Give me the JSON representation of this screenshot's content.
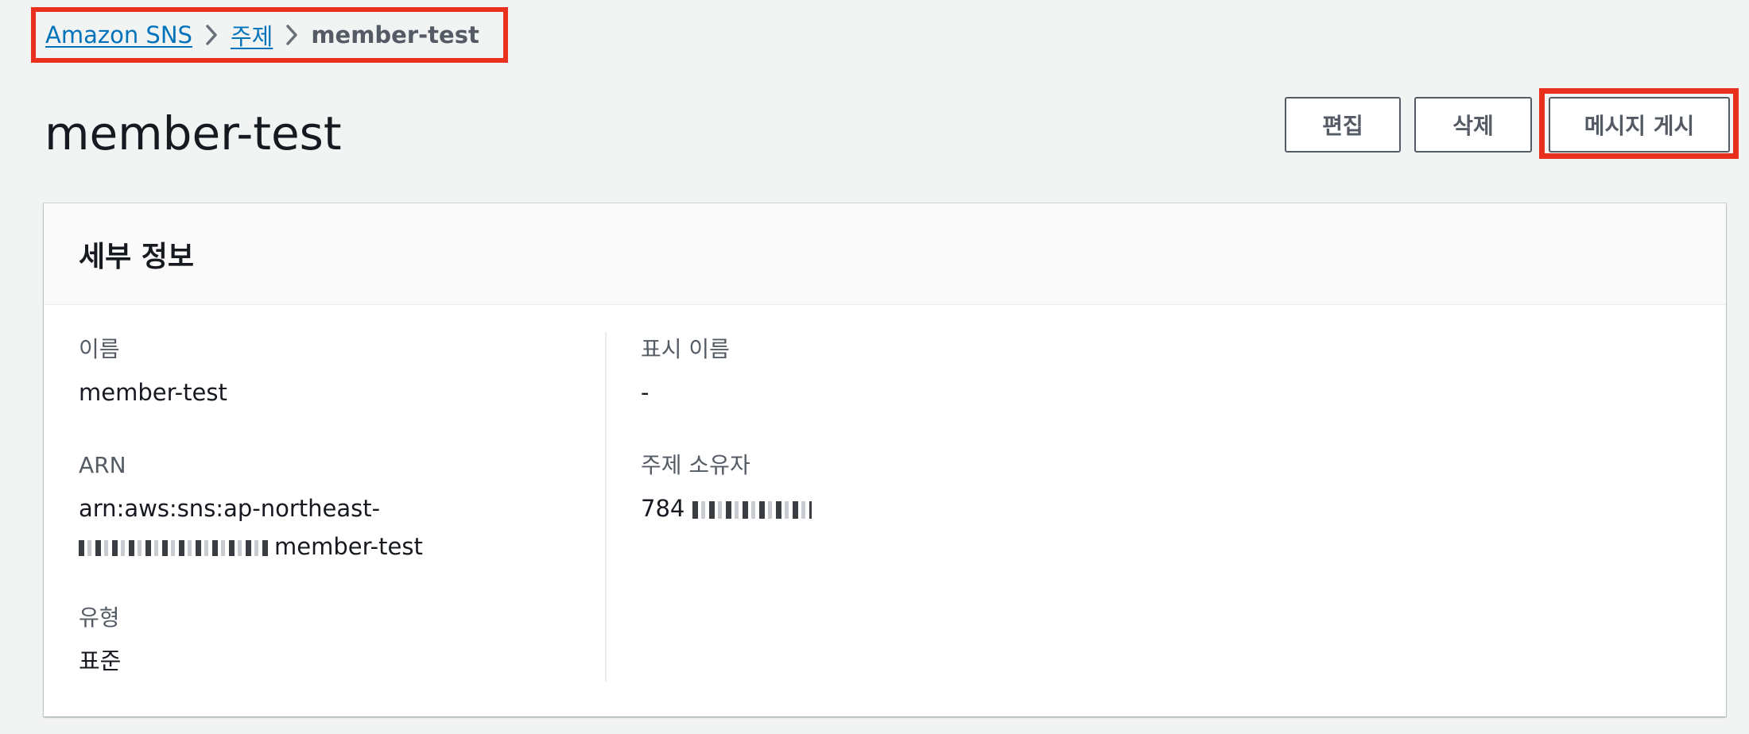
{
  "breadcrumb": {
    "items": [
      "Amazon SNS",
      "주제"
    ],
    "current": "member-test"
  },
  "header": {
    "title": "member-test",
    "buttons": {
      "edit": "편집",
      "delete": "삭제",
      "publish": "메시지 게시"
    }
  },
  "details": {
    "title": "세부 정보",
    "name_label": "이름",
    "name_value": "member-test",
    "arn_label": "ARN",
    "arn_line1": "arn:aws:sns:ap-northeast-",
    "arn_line2_suffix": "member-test",
    "type_label": "유형",
    "type_value": "표준",
    "display_name_label": "표시 이름",
    "display_name_value": "-",
    "owner_label": "주제 소유자",
    "owner_value_prefix": "784"
  },
  "colors": {
    "link": "#0073bb",
    "highlight": "#e8301c",
    "page_background": "#f2f3f3"
  }
}
